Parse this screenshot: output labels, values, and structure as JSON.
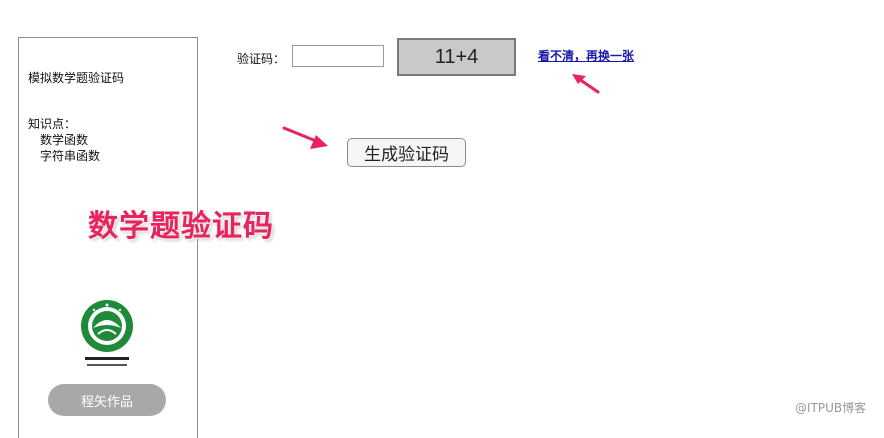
{
  "sidebar": {
    "title": "模拟数学题验证码",
    "knowledge_label": "知识点：",
    "knowledge_items": [
      "数学函数",
      "字符串函数"
    ],
    "logo_icon": "school-emblem-icon",
    "author_button": "程矢作品"
  },
  "captcha": {
    "label": "验证码：",
    "input_value": "",
    "input_placeholder": "",
    "image_text": "11+4",
    "refresh_link": "看不清，再换一张"
  },
  "generate_button": "生成验证码",
  "overlay_title": "数学题验证码",
  "watermark": "@ITPUB博客",
  "colors": {
    "annotation_accent": "#e8245f",
    "link": "#1a1aa6",
    "captcha_bg": "#c9c9c9",
    "author_button_bg": "#a8a8a8"
  }
}
